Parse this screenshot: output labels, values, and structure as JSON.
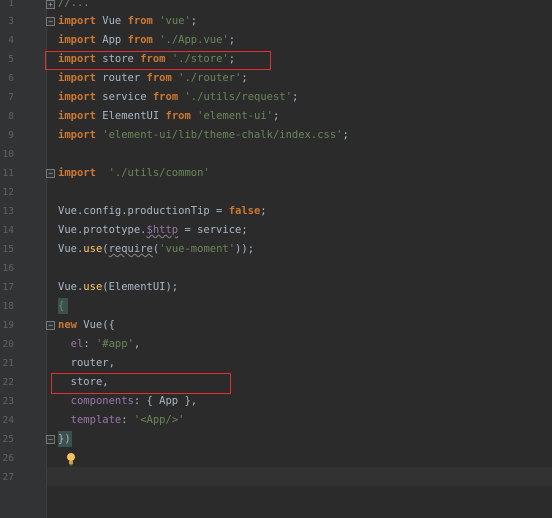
{
  "editor": {
    "lines": [
      {
        "num": "1",
        "text": "//..."
      },
      {
        "num": "3",
        "text": ""
      },
      {
        "num": "4",
        "text": ""
      },
      {
        "num": "5",
        "text": ""
      },
      {
        "num": "6",
        "text": ""
      },
      {
        "num": "7",
        "text": ""
      },
      {
        "num": "8",
        "text": ""
      },
      {
        "num": "9",
        "text": ""
      },
      {
        "num": "10",
        "text": ""
      },
      {
        "num": "11",
        "text": ""
      },
      {
        "num": "12",
        "text": ""
      },
      {
        "num": "13",
        "text": ""
      },
      {
        "num": "14",
        "text": ""
      },
      {
        "num": "15",
        "text": ""
      },
      {
        "num": "16",
        "text": ""
      },
      {
        "num": "17",
        "text": ""
      },
      {
        "num": "18",
        "text": ""
      },
      {
        "num": "19",
        "text": ""
      },
      {
        "num": "20",
        "text": ""
      },
      {
        "num": "21",
        "text": ""
      },
      {
        "num": "22",
        "text": ""
      },
      {
        "num": "23",
        "text": ""
      },
      {
        "num": "24",
        "text": ""
      },
      {
        "num": "25",
        "text": ""
      },
      {
        "num": "26",
        "text": ""
      },
      {
        "num": "27",
        "text": ""
      }
    ],
    "tokens": {
      "import": "import",
      "from": "from",
      "new": "new",
      "false": "false",
      "vue_id": "Vue",
      "vue_str": "'vue'",
      "app_id": "App",
      "app_str": "'./App.vue'",
      "store_id": "store",
      "store_str": "'./store'",
      "router_id": "router",
      "router_str": "'./router'",
      "service_id": "service",
      "service_str": "'./utils/request'",
      "elementui_id": "ElementUI",
      "elementui_str": "'element-ui'",
      "css_str": "'element-ui/lib/theme-chalk/index.css'",
      "common_str": "'./utils/common'",
      "vue_config": "Vue.config.productionTip = ",
      "semicolon": ";",
      "vue_proto": "Vue.prototype.",
      "http_prop": "$http",
      "eq_service": " = service;",
      "vue_dot": "Vue.",
      "use": "use",
      "require": "require",
      "moment_str": "'vue-moment'",
      "paren_close2": "));",
      "elementui_call": "(ElementUI);",
      "open_paren": "(",
      "vue_open": " Vue({",
      "el_key": "el",
      "el_val": "'#app'",
      "router_line": "router,",
      "store_line": "store,",
      "components_key": "components",
      "components_val": ": { App },",
      "template_key": "template",
      "template_val": "'<App/>'",
      "close": "})",
      "bracket_1": "{",
      "colon": ": ",
      "comma": ","
    }
  },
  "colors": {
    "background": "#2b2b2b",
    "keyword": "#cc7832",
    "string": "#6a8759",
    "property": "#9876aa",
    "highlight_box": "#e03030"
  },
  "icons": {
    "fold": "fold-toggle-icon",
    "bulb": "lightbulb-icon"
  }
}
